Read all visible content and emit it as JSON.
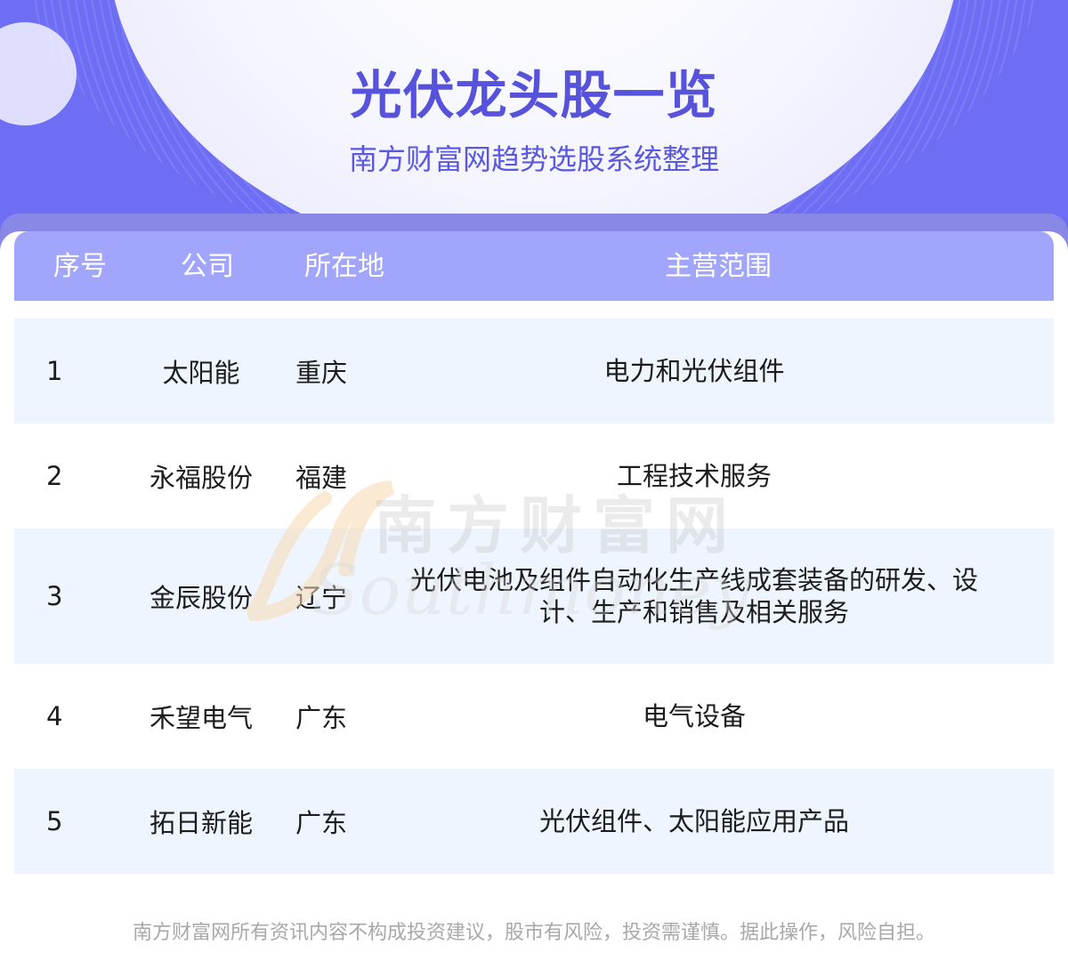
{
  "header": {
    "title": "光伏龙头股一览",
    "subtitle": "南方财富网趋势选股系统整理"
  },
  "table": {
    "columns": [
      "序号",
      "公司",
      "所在地",
      "主营范围"
    ],
    "rows": [
      {
        "index": "1",
        "company": "太阳能",
        "location": "重庆",
        "business": "电力和光伏组件"
      },
      {
        "index": "2",
        "company": "永福股份",
        "location": "福建",
        "business": "工程技术服务"
      },
      {
        "index": "3",
        "company": "金辰股份",
        "location": "辽宁",
        "business": "光伏电池及组件自动化生产线成套装备的研发、设计、生产和销售及相关服务"
      },
      {
        "index": "4",
        "company": "禾望电气",
        "location": "广东",
        "business": "电气设备"
      },
      {
        "index": "5",
        "company": "拓日新能",
        "location": "广东",
        "business": "光伏组件、太阳能应用产品"
      }
    ]
  },
  "watermark": {
    "brand_cn": "南方财富网",
    "brand_latin": "Southmoney"
  },
  "footer": {
    "disclaimer": "南方财富网所有资讯内容不构成投资建议，股市有风险，投资需谨慎。据此操作，风险自担。"
  },
  "colors": {
    "hero_background": "#6e6ef5",
    "title": "#5652dc",
    "table_header": "#a1a5fb",
    "row_alternate": "#eff5fe",
    "footer_text": "#a8a8a8"
  }
}
